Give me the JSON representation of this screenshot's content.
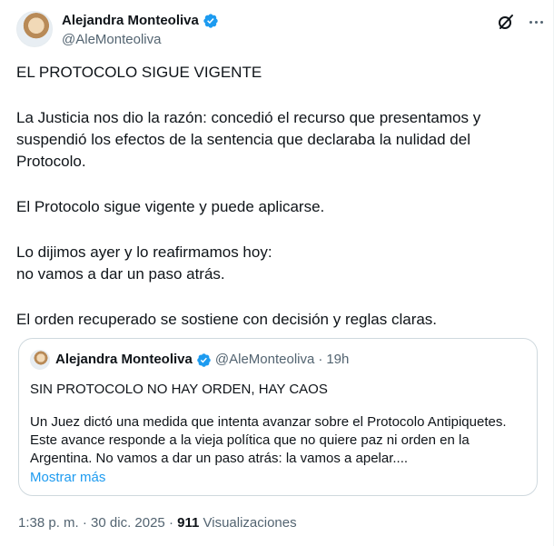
{
  "author": {
    "display_name": "Alejandra Monteoliva",
    "handle": "@AleMonteoliva"
  },
  "icons": {
    "verified": "verified-badge-icon",
    "grok": "grok-icon",
    "more": "more-icon"
  },
  "colors": {
    "verified": "#1d9bf0",
    "link": "#1d9bf0",
    "secondary_text": "#536471",
    "border": "#cfd9de"
  },
  "tweet": {
    "headline": "EL PROTOCOLO SIGUE VIGENTE",
    "para1": [
      "La Justicia nos dio la razón: concedió el recurso que presentamos y",
      "suspendió los efectos de la sentencia que declaraba la nulidad del",
      "Protocolo."
    ],
    "para2": "El Protocolo sigue vigente y puede aplicarse.",
    "para3": [
      "Lo dijimos ayer y lo reafirmamos hoy:",
      "no vamos a dar un paso atrás."
    ],
    "para4": "El orden recuperado se sostiene con decisión y reglas claras."
  },
  "quoted": {
    "display_name": "Alejandra Monteoliva",
    "handle": "@AleMonteoliva",
    "separator": "·",
    "time": "19h",
    "title": "SIN PROTOCOLO NO HAY ORDEN, HAY CAOS",
    "text": [
      "Un Juez dictó una medida que intenta avanzar sobre el Protocolo Antipiquetes.",
      "Este avance responde a la vieja política que no quiere paz ni orden en la",
      "Argentina. No vamos a dar un paso atrás: la vamos a apelar...."
    ],
    "show_more": "Mostrar más"
  },
  "meta": {
    "time": "1:38 p. m.",
    "separator": "·",
    "date": "30 dic. 2025",
    "views_count": "911",
    "views_label": "Visualizaciones"
  }
}
